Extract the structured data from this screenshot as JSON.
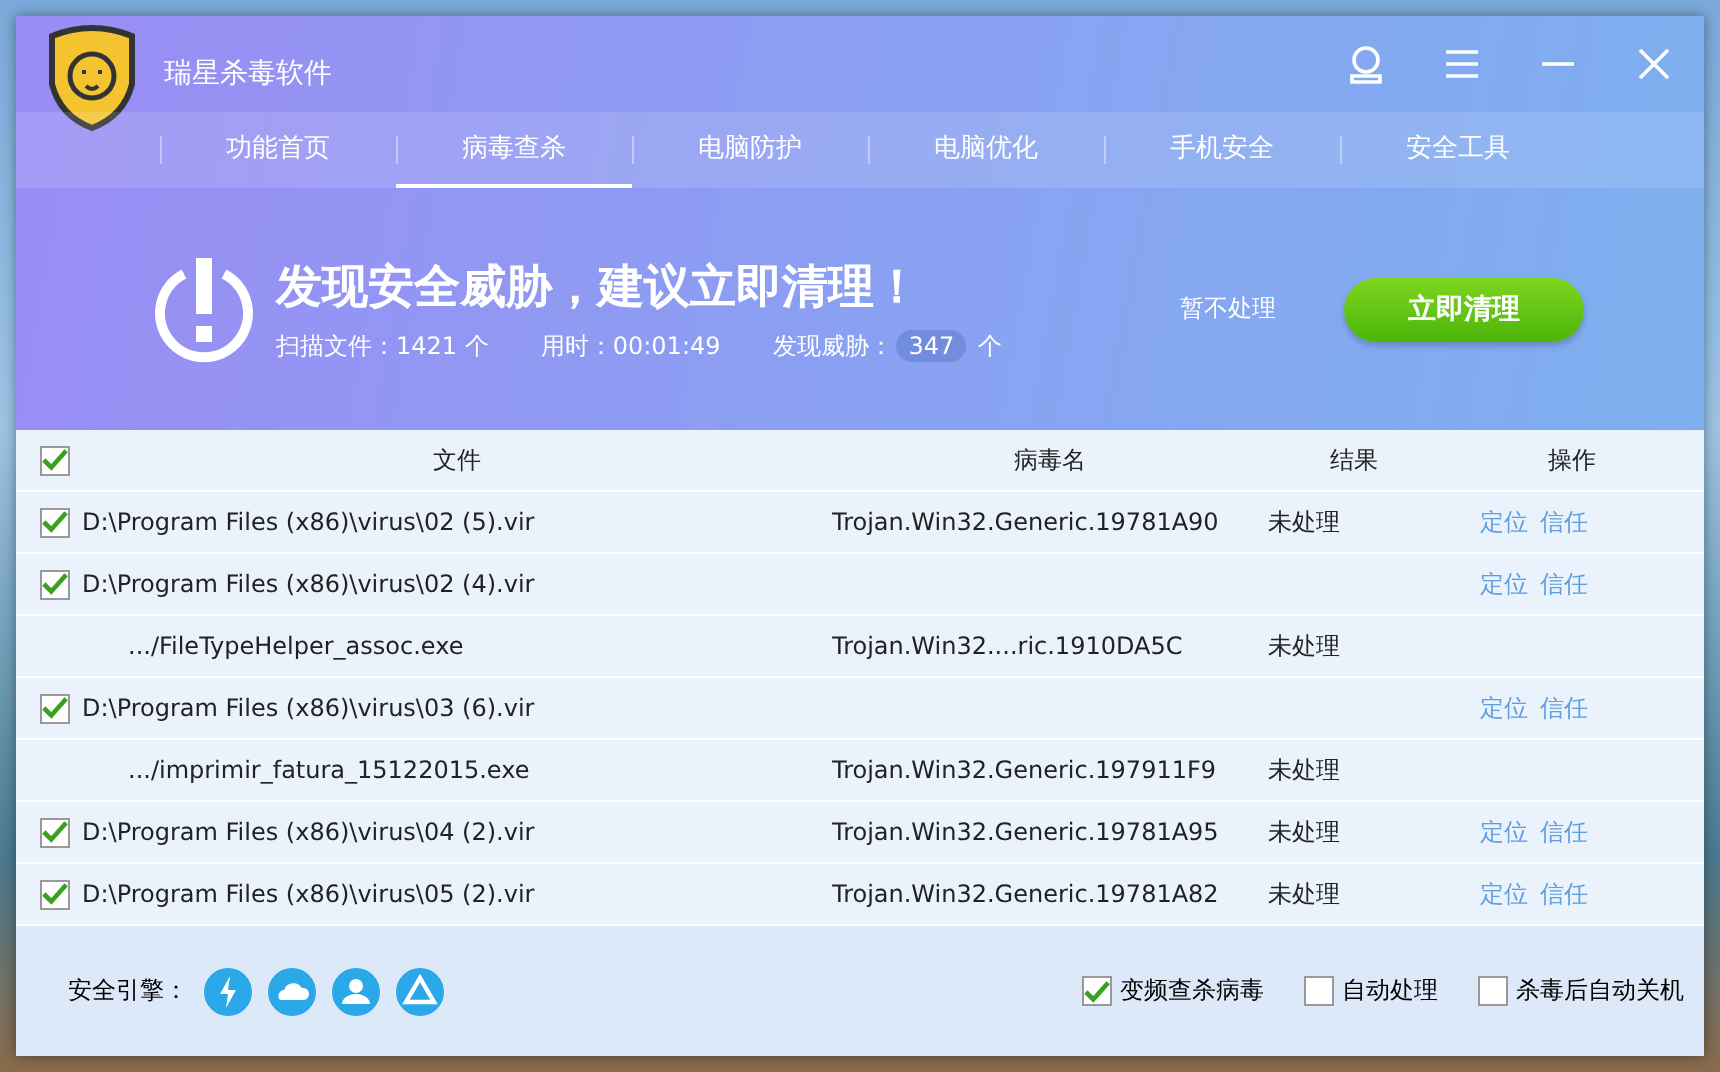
{
  "app": {
    "title": "瑞星杀毒软件"
  },
  "tabs": [
    {
      "label": "功能首页",
      "selected": false
    },
    {
      "label": "病毒查杀",
      "selected": true
    },
    {
      "label": "电脑防护",
      "selected": false
    },
    {
      "label": "电脑优化",
      "selected": false
    },
    {
      "label": "手机安全",
      "selected": false
    },
    {
      "label": "安全工具",
      "selected": false
    }
  ],
  "alert": {
    "headline": "发现安全威胁，建议立即清理！",
    "scanned_label": "扫描文件：1421 个",
    "time_label": "用时：00:01:49",
    "threats_label": "发现威胁：",
    "threats_count": "347",
    "threats_unit": "个",
    "ignore_link": "暂不处理",
    "clean_button": "立即清理"
  },
  "table": {
    "select_all_checked": true,
    "columns": [
      "文件",
      "病毒名",
      "结果",
      "操作"
    ],
    "rows": [
      {
        "kind": "file",
        "checked": true,
        "file": "D:\\Program Files (x86)\\virus\\02 (5).vir",
        "virus": "Trojan.Win32.Generic.19781A90",
        "result": "未处理",
        "actions": [
          "定位",
          "信任"
        ]
      },
      {
        "kind": "file",
        "checked": true,
        "file": "D:\\Program Files (x86)\\virus\\02 (4).vir",
        "actions": [
          "定位",
          "信任"
        ]
      },
      {
        "kind": "child",
        "file": ".../FileTypeHelper_assoc.exe",
        "virus": "Trojan.Win32....ric.1910DA5C",
        "result": "未处理"
      },
      {
        "kind": "file",
        "checked": true,
        "file": "D:\\Program Files (x86)\\virus\\03 (6).vir",
        "actions": [
          "定位",
          "信任"
        ]
      },
      {
        "kind": "child",
        "file": ".../imprimir_fatura_15122015.exe",
        "virus": "Trojan.Win32.Generic.197911F9",
        "result": "未处理"
      },
      {
        "kind": "file",
        "checked": true,
        "file": "D:\\Program Files (x86)\\virus\\04 (2).vir",
        "virus": "Trojan.Win32.Generic.19781A95",
        "result": "未处理",
        "actions": [
          "定位",
          "信任"
        ]
      },
      {
        "kind": "file",
        "checked": true,
        "file": "D:\\Program Files (x86)\\virus\\05 (2).vir",
        "virus": "Trojan.Win32.Generic.19781A82",
        "result": "未处理",
        "actions": [
          "定位",
          "信任"
        ]
      }
    ]
  },
  "footer": {
    "engine_label": "安全引擎：",
    "options": [
      {
        "label": "变频查杀病毒",
        "checked": true
      },
      {
        "label": "自动处理",
        "checked": false
      },
      {
        "label": "杀毒后自动关机",
        "checked": false
      }
    ]
  }
}
